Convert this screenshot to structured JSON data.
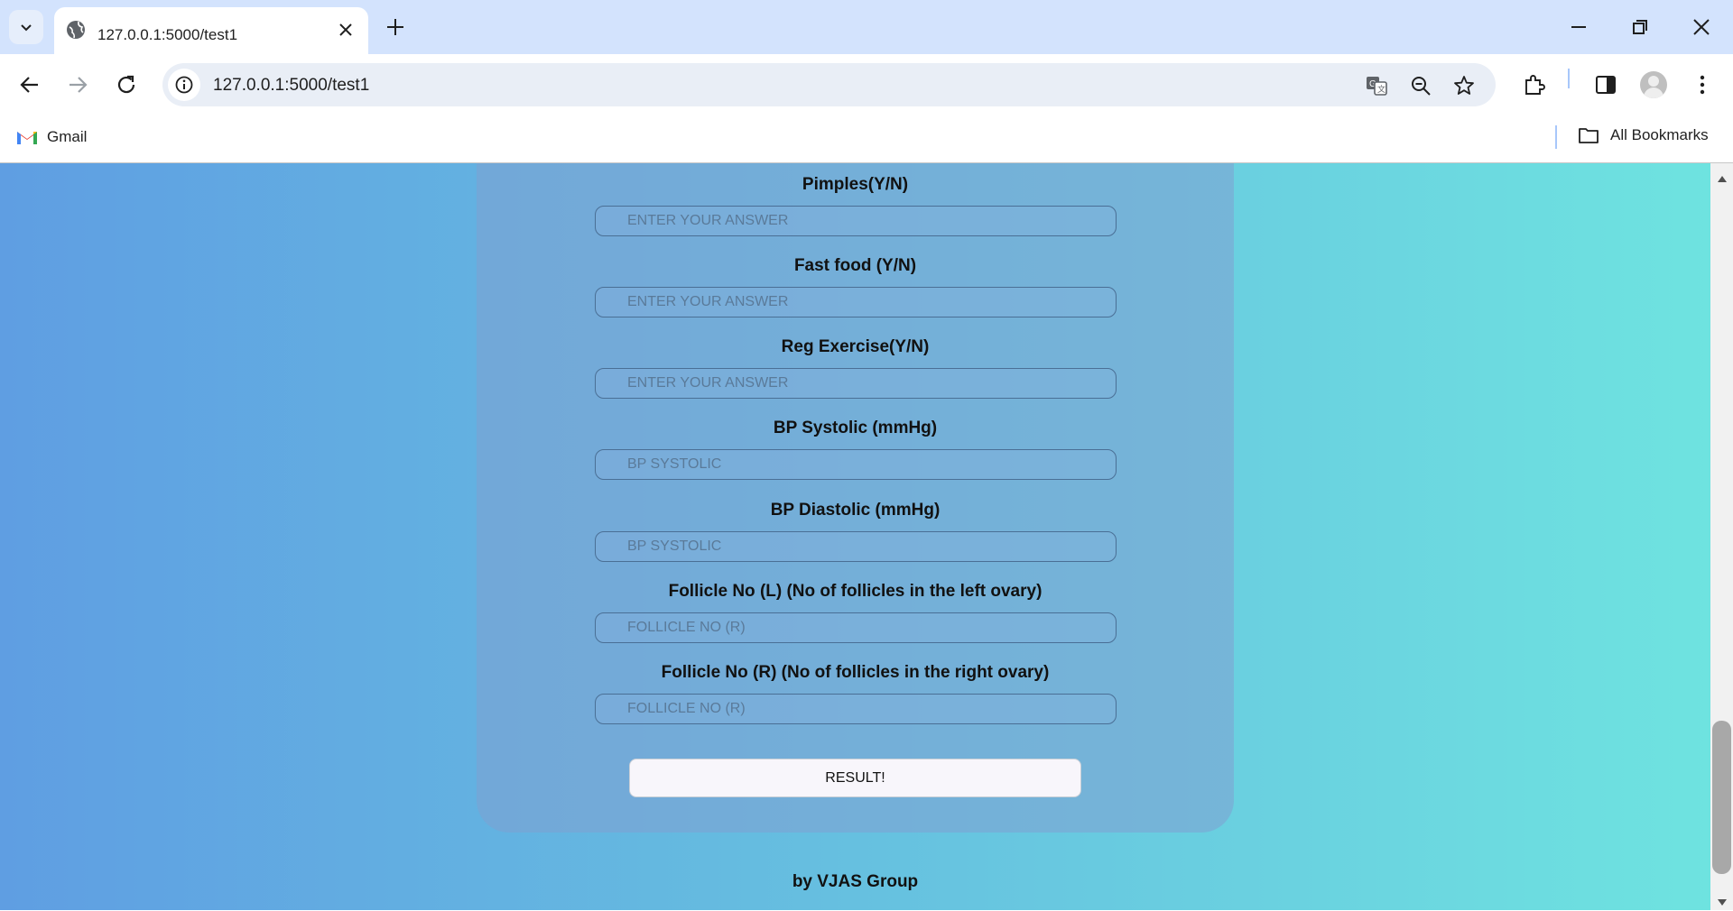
{
  "browser": {
    "tab_title": "127.0.0.1:5000/test1",
    "url": "127.0.0.1:5000/test1",
    "bookmarks": {
      "gmail": "Gmail",
      "all_bookmarks": "All Bookmarks"
    }
  },
  "form": {
    "fields": [
      {
        "label": "Pimples(Y/N)",
        "placeholder": "ENTER YOUR ANSWER"
      },
      {
        "label": "Fast food (Y/N)",
        "placeholder": "ENTER YOUR ANSWER"
      },
      {
        "label": "Reg Exercise(Y/N)",
        "placeholder": "ENTER YOUR ANSWER"
      },
      {
        "label": "BP Systolic (mmHg)",
        "placeholder": "BP SYSTOLIC"
      },
      {
        "label": "BP Diastolic (mmHg)",
        "placeholder": "BP SYSTOLIC"
      },
      {
        "label": "Follicle No (L) (No of follicles in the left ovary)",
        "placeholder": "FOLLICLE NO (R)"
      },
      {
        "label": "Follicle No (R) (No of follicles in the right ovary)",
        "placeholder": "FOLLICLE NO (R)"
      }
    ],
    "submit_label": "RESULT!"
  },
  "footer": {
    "credit": "by VJAS Group"
  }
}
